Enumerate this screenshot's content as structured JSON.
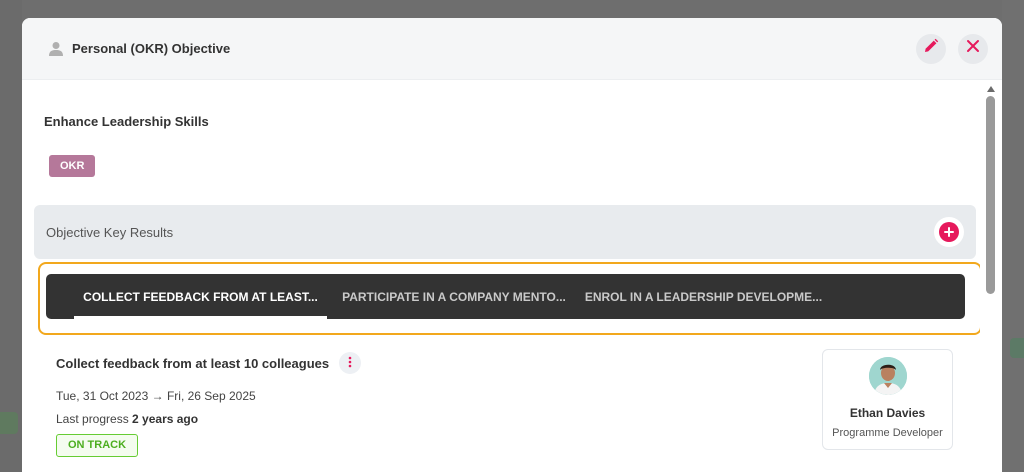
{
  "modal": {
    "title": "Personal (OKR) Objective",
    "icons": {
      "type": "person-icon",
      "edit": "pencil-icon",
      "close": "close-icon"
    }
  },
  "objective": {
    "title": "Enhance Leadership Skills",
    "badge": "OKR"
  },
  "key_results_section": {
    "label": "Objective Key Results",
    "add_icon": "plus-circle-icon"
  },
  "tabs": [
    {
      "label": "COLLECT FEEDBACK FROM AT LEAST...",
      "active": true
    },
    {
      "label": "PARTICIPATE IN A COMPANY MENTO...",
      "active": false
    },
    {
      "label": "ENROL IN A LEADERSHIP DEVELOPME...",
      "active": false
    }
  ],
  "key_result": {
    "title": "Collect feedback from at least 10 colleagues",
    "dates": "Tue, 31 Oct 2023 → Fri, 26 Sep 2025",
    "last_progress_label": "Last progress",
    "last_progress_value": "2 years ago",
    "status": "ON TRACK",
    "owner": {
      "name": "Ethan Davies",
      "role": "Programme Developer"
    }
  },
  "colors": {
    "accent": "#e6195c",
    "badge": "#b5789a",
    "tabs_bg": "#333333",
    "highlight": "#f2a81d",
    "status": "#66cc33"
  }
}
